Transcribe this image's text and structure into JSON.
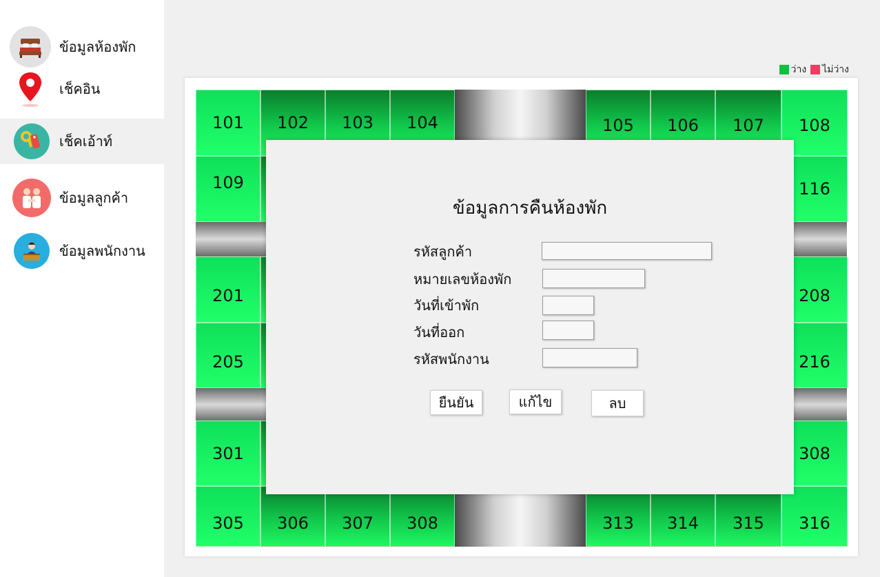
{
  "sidebar": {
    "items": [
      {
        "label": "ข้อมูลห้องพัก",
        "icon": "bed-icon"
      },
      {
        "label": "เช็คอิน",
        "icon": "map-pin-icon"
      },
      {
        "label": "เช็คเอ้าท์",
        "icon": "key-icon"
      },
      {
        "label": "ข้อมูลลูกค้า",
        "icon": "handshake-icon"
      },
      {
        "label": "ข้อมูลพนักงาน",
        "icon": "receptionist-icon"
      }
    ],
    "active_index": 2
  },
  "legend": {
    "available_label": "ว่าง",
    "occupied_label": "ไม่ว่าง",
    "available_color": "#10c040",
    "occupied_color": "#f03c64"
  },
  "rooms": {
    "floor1_top": [
      "101",
      "102",
      "103",
      "104",
      "105",
      "106",
      "107",
      "108"
    ],
    "floor1_bottom": [
      "109",
      "116"
    ],
    "floor2_top": [
      "201",
      "208"
    ],
    "floor2_bottom": [
      "205",
      "216"
    ],
    "floor3_top": [
      "301",
      "308"
    ],
    "floor3_bottom": [
      "305",
      "306",
      "307",
      "308",
      "313",
      "314",
      "315",
      "316"
    ]
  },
  "dialog": {
    "title": "ข้อมูลการคืนห้องพัก",
    "fields": {
      "customer_id": {
        "label": "รหัสลูกค้า",
        "value": ""
      },
      "room_number": {
        "label": "หมายเลขห้องพัก",
        "value": ""
      },
      "checkin_date": {
        "label": "วันที่เข้าพัก",
        "value": ""
      },
      "checkout_date": {
        "label": "วันที่ออก",
        "value": ""
      },
      "employee_id": {
        "label": "รหัสพนักงาน",
        "value": ""
      }
    },
    "buttons": {
      "confirm": "ยืนยัน",
      "edit": "แก้ไข",
      "delete": "ลบ"
    }
  }
}
